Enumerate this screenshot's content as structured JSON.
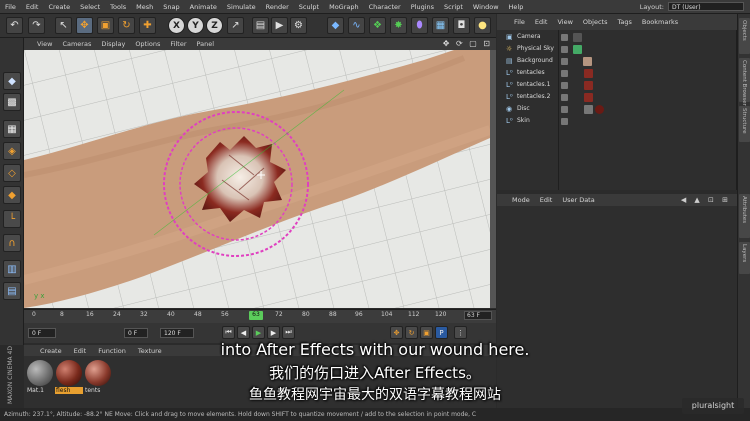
{
  "menu_bar": {
    "items": [
      "File",
      "Edit",
      "Create",
      "Select",
      "Tools",
      "Mesh",
      "Snap",
      "Animate",
      "Simulate",
      "Render",
      "Sculpt",
      "MoGraph",
      "Character",
      "Plugins",
      "Script",
      "Window",
      "Help"
    ],
    "layout_label": "Layout:",
    "layout_value": "DT (User)"
  },
  "toolbar": {
    "x_label": "X",
    "y_label": "Y",
    "z_label": "Z"
  },
  "viewport": {
    "menu": [
      "View",
      "Cameras",
      "Display",
      "Options",
      "Filter",
      "Panel"
    ],
    "nav_icons": "✥ ⟳ ▢ ⊡",
    "axis": "y x"
  },
  "timeline": {
    "ticks": [
      "0",
      "8",
      "16",
      "24",
      "32",
      "40",
      "48",
      "56",
      "63",
      "72",
      "80",
      "88",
      "96",
      "104",
      "112",
      "120"
    ],
    "current_frame": "63",
    "end_display": "63 F",
    "start_field": "0 F",
    "range_field": "120 F",
    "current_field": "0 F"
  },
  "materials": {
    "menu": [
      "Create",
      "Edit",
      "Function",
      "Texture"
    ],
    "items": [
      {
        "label": "Mat.1",
        "color": "#6e6e6e",
        "selected": false
      },
      {
        "label": "flesh",
        "color": "#7a2a1c",
        "selected": true
      },
      {
        "label": "tents",
        "color": "#8a3a2c",
        "selected": false
      }
    ]
  },
  "maxon": "MAXON CINEMA 4D",
  "status_bar": "Azimuth: 237.1°, Altitude: -88.2°  NE   Move: Click and drag to move elements. Hold down SHIFT to quantize movement / add to the selection in point mode, C",
  "object_manager": {
    "menu": [
      "File",
      "Edit",
      "View",
      "Objects",
      "Tags",
      "Bookmarks"
    ],
    "objects": [
      {
        "name": "Camera",
        "icon": "▣"
      },
      {
        "name": "Physical Sky",
        "icon": "☼"
      },
      {
        "name": "Background",
        "icon": "▤"
      },
      {
        "name": "tentacles",
        "icon": "L⁰"
      },
      {
        "name": "tentacles.1",
        "icon": "L⁰"
      },
      {
        "name": "tentacles.2",
        "icon": "L⁰"
      },
      {
        "name": "Disc",
        "icon": "◉"
      },
      {
        "name": "Skin",
        "icon": "L⁰"
      }
    ]
  },
  "attributes": {
    "menu": [
      "Mode",
      "Edit",
      "User Data"
    ]
  },
  "right_tabs": [
    "Objects",
    "Content Browser",
    "Structure",
    "Attributes",
    "Layers"
  ],
  "subtitles": {
    "english": "into After Effects with our wound here.",
    "chinese": "我们的伤口进入After Effects。",
    "watermark": "鱼鱼教程网宇宙最大的双语字幕教程网站"
  },
  "brand": "pluralsight"
}
